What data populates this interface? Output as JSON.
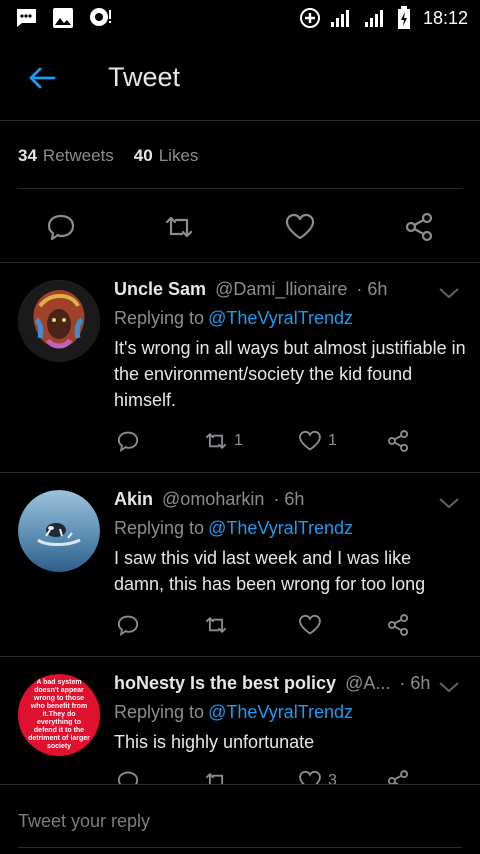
{
  "status_bar": {
    "time": "18:12",
    "icons": [
      "message-icon",
      "image-icon",
      "notification-icon",
      "add-circle-icon",
      "signal-icon",
      "signal-icon",
      "battery-icon"
    ]
  },
  "header": {
    "title": "Tweet",
    "back_icon": "arrow-left-icon"
  },
  "stats": {
    "retweets_count": "34",
    "retweets_label": "Retweets",
    "likes_count": "40",
    "likes_label": "Likes"
  },
  "colors": {
    "accent": "#1d9bf0",
    "background": "#000000",
    "text": "#e6e6e6",
    "muted": "#8a8d91",
    "divider": "#2a2a2a"
  },
  "replies": [
    {
      "name": "Uncle Sam",
      "handle": "@Dami_llionaire",
      "time": "· 6h",
      "replying_label": "Replying to",
      "replying_to": "@TheVyralTrendz",
      "text": "It's wrong in all  ways but almost justifiable in the environment/society the kid found himself.",
      "retweets": "1",
      "likes": "1"
    },
    {
      "name": "Akin",
      "handle": "@omoharkin",
      "time": "· 6h",
      "replying_label": "Replying to",
      "replying_to": "@TheVyralTrendz",
      "text": "I saw this vid last week and I was like damn, this has been wrong for too long",
      "retweets": "",
      "likes": ""
    },
    {
      "name": "hoNesty Is the best policy",
      "handle": "@A...",
      "time": "· 6h",
      "replying_label": "Replying to",
      "replying_to": "@TheVyralTrendz",
      "text": "This is highly unfortunate",
      "avatar_text": "A bad system doesn't appear wrong to those who benefit from it.They do everything to defend it to the detriment of larger society",
      "retweets": "",
      "likes": "3"
    }
  ],
  "compose": {
    "placeholder": "Tweet your reply"
  }
}
